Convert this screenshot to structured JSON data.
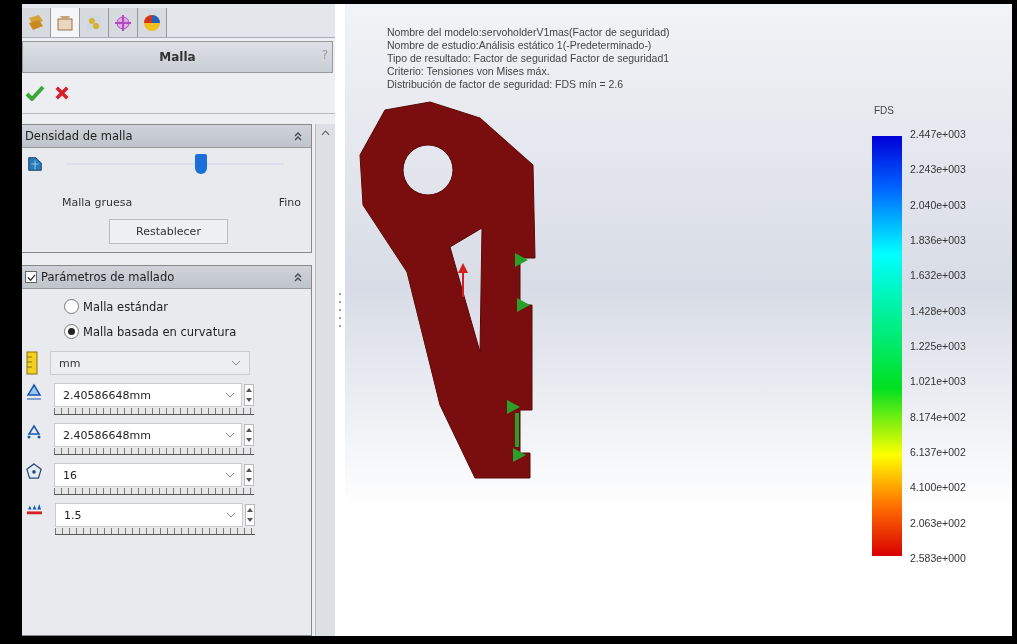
{
  "tabs": [
    {
      "selected": false
    },
    {
      "selected": true
    },
    {
      "selected": false
    },
    {
      "selected": false
    },
    {
      "selected": false
    }
  ],
  "panel": {
    "title": "Malla",
    "help": "?"
  },
  "density": {
    "title": "Densidad de malla",
    "expanded": true,
    "level": 0.62,
    "label_min": "Malla gruesa",
    "label_max": "Fino",
    "button": "Restablecer"
  },
  "params": {
    "title": "Parámetros de mallado",
    "checked": true,
    "expanded": true,
    "options": [
      {
        "label": "Malla estándar",
        "selected": false
      },
      {
        "label": "Malla basada en curvatura",
        "selected": true
      }
    ],
    "unit": "mm",
    "fields": [
      {
        "value": "2.40586648mm"
      },
      {
        "value": "2.40586648mm"
      },
      {
        "value": "16"
      },
      {
        "value": "1.5"
      }
    ]
  },
  "viewport": {
    "info": [
      "Nombre del modelo:servoholderV1mas(Factor de seguridad)",
      "Nombre de estudio:Análisis estático 1(-Predeterminado-)",
      "Tipo de resultado: Factor de seguridad Factor de seguridad1",
      "Criterio: Tensiones von Mises máx.",
      "Distribución de factor de seguridad: FDS mín = 2.6"
    ],
    "legend": {
      "title": "FDS",
      "labels": [
        "2.447e+003",
        "2.243e+003",
        "2.040e+003",
        "1.836e+003",
        "1.632e+003",
        "1.428e+003",
        "1.225e+003",
        "1.021e+003",
        "8.174e+002",
        "6.137e+002",
        "4.100e+002",
        "2.063e+002",
        "2.583e+000"
      ]
    }
  }
}
